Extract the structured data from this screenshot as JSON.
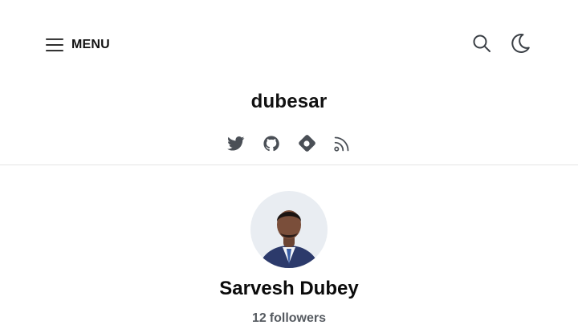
{
  "header": {
    "menu_label": "MENU",
    "blog_title": "dubesar",
    "icons": {
      "menu": "hamburger-icon",
      "search": "search-icon",
      "theme": "moon-icon"
    },
    "socials": [
      {
        "name": "twitter",
        "icon": "twitter-icon"
      },
      {
        "name": "github",
        "icon": "github-icon"
      },
      {
        "name": "hashnode",
        "icon": "hashnode-icon"
      },
      {
        "name": "rss",
        "icon": "rss-icon"
      }
    ]
  },
  "profile": {
    "author_name": "Sarvesh Dubey",
    "followers_count": "12",
    "followers_label": "followers"
  },
  "colors": {
    "text": "#111111",
    "muted": "#555a60",
    "icon": "#3f444b",
    "divider": "#e5e5e5"
  }
}
